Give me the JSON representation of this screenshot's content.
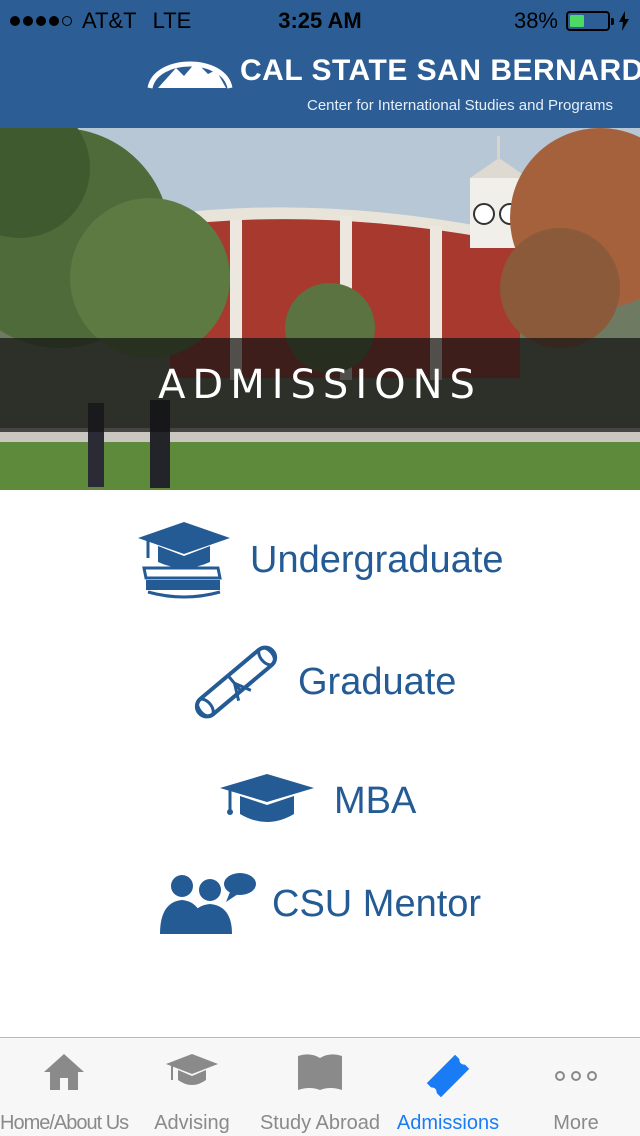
{
  "status_bar": {
    "carrier": "AT&T",
    "network": "LTE",
    "time": "3:25 AM",
    "battery_percent": "38%",
    "battery_level": 0.38
  },
  "header": {
    "title": "CAL STATE SAN BERNARDINO",
    "subtitle": "Center for International Studies and Programs"
  },
  "hero": {
    "title": "ADMISSIONS"
  },
  "menu": {
    "undergraduate": "Undergraduate",
    "graduate": "Graduate",
    "mba": "MBA",
    "csu_mentor": "CSU Mentor"
  },
  "tabs": {
    "home": "Home/About Us",
    "advising": "Advising",
    "study_abroad": "Study Abroad",
    "admissions": "Admissions",
    "more": "More"
  },
  "colors": {
    "brand_blue": "#2c5e95",
    "menu_blue": "#245b94",
    "active_tab": "#1a7cf5",
    "inactive_tab": "#8a8a8a"
  }
}
